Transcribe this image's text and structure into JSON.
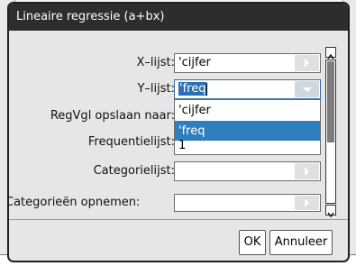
{
  "dialog": {
    "title": "Lineaire regressie (a+bx)",
    "fields": [
      {
        "label": "X–lijst:",
        "value": "'cijfer"
      },
      {
        "label": "Y–lijst:",
        "value": "'freq"
      },
      {
        "label": "RegVgl opslaan naar:",
        "value": ""
      },
      {
        "label": "Frequentielijst:",
        "value": "1"
      },
      {
        "label": "Categorielijst:",
        "value": ""
      },
      {
        "label": "Categorieën opnemen:",
        "value": ""
      }
    ],
    "dropdown": {
      "options": [
        "'cijfer",
        "'freq"
      ],
      "highlighted": "'freq"
    },
    "buttons": {
      "ok": "OK",
      "cancel": "Annuleer"
    }
  },
  "colors": {
    "titlebar": "#2d2d2d",
    "highlight": "#2f7fbe"
  }
}
